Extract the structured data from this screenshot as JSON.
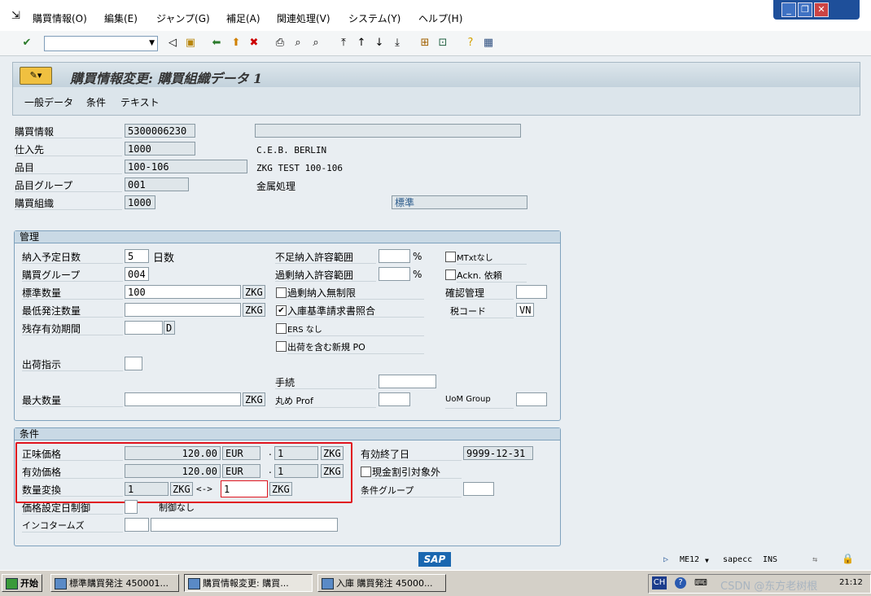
{
  "menubar": {
    "items": [
      "購買情報(O)",
      "編集(E)",
      "ジャンプ(G)",
      "補足(A)",
      "関連処理(V)",
      "システム(Y)",
      "ヘルプ(H)"
    ]
  },
  "window_controls": {
    "minimize": "_",
    "restore": "❐",
    "close": "✕"
  },
  "toolbar": {
    "command_field_value": ""
  },
  "title": "購買情報変更: 購買組織データ 1",
  "app_toolbar": [
    "一般データ",
    "条件",
    "テキスト"
  ],
  "header": {
    "purch_info_label": "購買情報",
    "purch_info_value": "5300006230",
    "purch_info_desc": "",
    "vendor_label": "仕入先",
    "vendor_value": "1000",
    "vendor_name": "C.E.B. BERLIN",
    "material_label": "品目",
    "material_value": "100-106",
    "material_desc": "ZKG TEST 100-106",
    "matgroup_label": "品目グループ",
    "matgroup_value": "001",
    "matgroup_desc": "金属処理",
    "purch_org_label": "購買組織",
    "purch_org_value": "1000",
    "type_value": "標準"
  },
  "control": {
    "title": "管理",
    "plan_deliv_label": "納入予定日数",
    "plan_deliv_value": "5",
    "plan_deliv_unit": "日数",
    "purch_group_label": "購買グループ",
    "purch_group_value": "004",
    "std_qty_label": "標準数量",
    "std_qty_value": "100",
    "std_qty_unit": "ZKG",
    "min_qty_label": "最低発注数量",
    "min_qty_value": "",
    "min_qty_unit": "ZKG",
    "rem_shelf_label": "残存有効期間",
    "rem_shelf_value": "",
    "rem_shelf_unit": "D",
    "ship_instr_label": "出荷指示",
    "ship_instr_value": "",
    "max_qty_label": "最大数量",
    "max_qty_value": "",
    "max_qty_unit": "ZKG",
    "under_tol_label": "不足納入許容範囲",
    "under_tol_unit": "%",
    "over_tol_label": "過剰納入許容範囲",
    "over_tol_unit": "%",
    "unlimited_label": "過剰納入無制限",
    "unlimited_checked": false,
    "gr_based_label": "入庫基準請求書照合",
    "gr_based_checked": true,
    "no_ers_label": "ERS なし",
    "no_ers_checked": false,
    "incl_po_label": "出荷を含む新規 PO",
    "incl_po_checked": false,
    "procedure_label": "手続",
    "rounding_label": "丸め Prof",
    "no_mtext_label": "MTxtなし",
    "no_mtext_checked": false,
    "ackn_label": "Ackn. 依頼",
    "ackn_checked": false,
    "conf_ctrl_label": "確認管理",
    "tax_code_label": "税コード",
    "tax_code_value": "VN",
    "uom_group_label": "UoM Group"
  },
  "conditions": {
    "title": "条件",
    "net_price_label": "正味価格",
    "net_price_value": "120.00",
    "net_price_cur": "EUR",
    "net_price_per": "1",
    "net_price_unit": "ZKG",
    "eff_price_label": "有効価格",
    "eff_price_value": "120.00",
    "eff_price_cur": "EUR",
    "eff_price_per": "1",
    "eff_price_unit": "ZKG",
    "qty_conv_label": "数量変換",
    "qty_conv_left": "1",
    "qty_conv_left_unit": "ZKG",
    "qty_conv_arrow": "<->",
    "qty_conv_right": "1",
    "qty_conv_right_unit": "ZKG",
    "valid_to_label": "有効終了日",
    "valid_to_value": "9999-12-31",
    "no_cash_disc_label": "現金割引対象外",
    "no_cash_disc_checked": false,
    "cond_group_label": "条件グループ",
    "cond_group_value": "",
    "price_ctrl_label": "価格設定日制御",
    "price_ctrl_value": "",
    "price_ctrl_text": "制御なし",
    "incoterms_label": "インコタームズ",
    "incoterms1": "",
    "incoterms2": ""
  },
  "statusbar": {
    "sap_logo": "SAP",
    "transaction": "ME12",
    "server": "sapecc",
    "mode": "INS"
  },
  "taskbar": {
    "start": "开始",
    "tasks": [
      "標準購買発注 450001...",
      "購買情報変更: 購買...",
      "入庫 購買発注 45000..."
    ],
    "lang": "CH",
    "clock": "21:12",
    "watermark": "CSDN @东方老树根"
  },
  "highlight_color": "#e0141e"
}
